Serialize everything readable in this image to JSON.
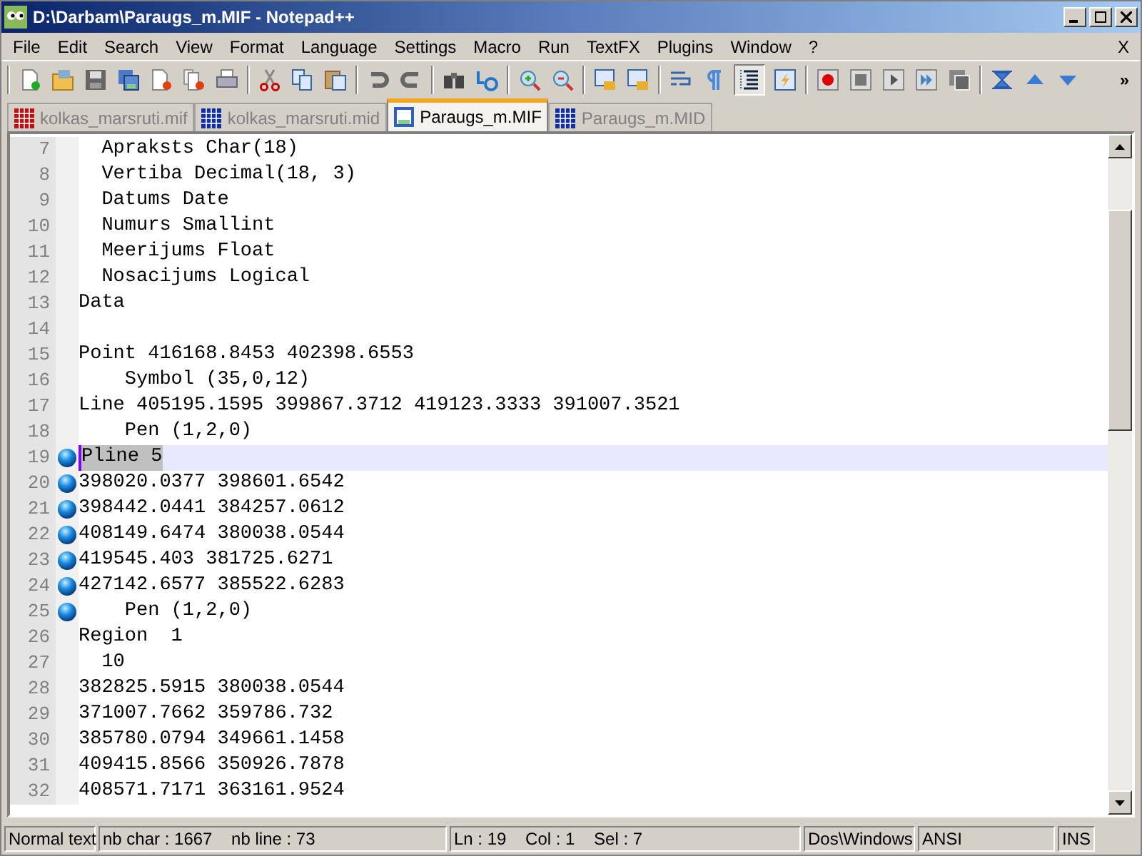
{
  "window": {
    "title": "D:\\Darbam\\Paraugs_m.MIF - Notepad++"
  },
  "menu": [
    "File",
    "Edit",
    "Search",
    "View",
    "Format",
    "Language",
    "Settings",
    "Macro",
    "Run",
    "TextFX",
    "Plugins",
    "Window",
    "?"
  ],
  "menu_close": "X",
  "toolbar": [
    {
      "kind": "new",
      "pressed": false
    },
    {
      "kind": "open",
      "pressed": false
    },
    {
      "kind": "save",
      "pressed": false
    },
    {
      "kind": "saveall",
      "pressed": false
    },
    {
      "kind": "close",
      "pressed": false
    },
    {
      "kind": "closeall",
      "pressed": false
    },
    {
      "kind": "print",
      "pressed": false
    },
    {
      "kind": "sep"
    },
    {
      "kind": "cut",
      "pressed": false
    },
    {
      "kind": "copy",
      "pressed": false
    },
    {
      "kind": "paste",
      "pressed": false
    },
    {
      "kind": "sep"
    },
    {
      "kind": "undo",
      "pressed": false
    },
    {
      "kind": "redo",
      "pressed": false
    },
    {
      "kind": "sep"
    },
    {
      "kind": "find",
      "pressed": false
    },
    {
      "kind": "replace",
      "pressed": false
    },
    {
      "kind": "sep"
    },
    {
      "kind": "zoomin",
      "pressed": false
    },
    {
      "kind": "zoomout",
      "pressed": false
    },
    {
      "kind": "sep"
    },
    {
      "kind": "lock",
      "pressed": false
    },
    {
      "kind": "lock",
      "pressed": false
    },
    {
      "kind": "sep"
    },
    {
      "kind": "wrap",
      "pressed": false
    },
    {
      "kind": "pilcrow",
      "pressed": false
    },
    {
      "kind": "indent",
      "pressed": true
    },
    {
      "kind": "lightning",
      "pressed": false
    },
    {
      "kind": "sep"
    },
    {
      "kind": "record",
      "pressed": false
    },
    {
      "kind": "stop",
      "pressed": false
    },
    {
      "kind": "play",
      "pressed": false
    },
    {
      "kind": "playmulti",
      "pressed": false
    },
    {
      "kind": "savemacro",
      "pressed": false
    },
    {
      "kind": "sep"
    },
    {
      "kind": "sync",
      "pressed": false
    },
    {
      "kind": "up",
      "pressed": false
    },
    {
      "kind": "down",
      "pressed": false
    }
  ],
  "toolbar_more": "»",
  "tabs": [
    {
      "label": "kolkas_marsruti.mif",
      "selected": false,
      "color": "#c01010"
    },
    {
      "label": "kolkas_marsruti.mid",
      "selected": false,
      "color": "#1030a0"
    },
    {
      "label": "Paraugs_m.MIF",
      "selected": true,
      "color": "#3060c0"
    },
    {
      "label": "Paraugs_m.MID",
      "selected": false,
      "color": "#1030a0"
    }
  ],
  "editor": {
    "lines": [
      {
        "number": "7",
        "text": "  Apraksts Char(18)",
        "bookmark": false,
        "current": false
      },
      {
        "number": "8",
        "text": "  Vertiba Decimal(18, 3)",
        "bookmark": false,
        "current": false
      },
      {
        "number": "9",
        "text": "  Datums Date",
        "bookmark": false,
        "current": false
      },
      {
        "number": "10",
        "text": "  Numurs Smallint",
        "bookmark": false,
        "current": false
      },
      {
        "number": "11",
        "text": "  Meerijums Float",
        "bookmark": false,
        "current": false
      },
      {
        "number": "12",
        "text": "  Nosacijums Logical",
        "bookmark": false,
        "current": false
      },
      {
        "number": "13",
        "text": "Data",
        "bookmark": false,
        "current": false
      },
      {
        "number": "14",
        "bookmark": false,
        "current": false
      },
      {
        "number": "15",
        "text": "Point 416168.8453 402398.6553",
        "bookmark": false,
        "current": false
      },
      {
        "number": "16",
        "text": "    Symbol (35,0,12)",
        "bookmark": false,
        "current": false
      },
      {
        "number": "17",
        "text": "Line 405195.1595 399867.3712 419123.3333 391007.3521",
        "bookmark": false,
        "current": false
      },
      {
        "number": "18",
        "text": "    Pen (1,2,0)",
        "bookmark": false,
        "current": false
      },
      {
        "number": "19",
        "text": "Pline 5",
        "bookmark": true,
        "current": true,
        "selected": true
      },
      {
        "number": "20",
        "text": "398020.0377 398601.6542",
        "bookmark": true,
        "current": false
      },
      {
        "number": "21",
        "text": "398442.0441 384257.0612",
        "bookmark": true,
        "current": false
      },
      {
        "number": "22",
        "text": "408149.6474 380038.0544",
        "bookmark": true,
        "current": false
      },
      {
        "number": "23",
        "text": "419545.403 381725.6271",
        "bookmark": true,
        "current": false
      },
      {
        "number": "24",
        "text": "427142.6577 385522.6283",
        "bookmark": true,
        "current": false
      },
      {
        "number": "25",
        "text": "    Pen (1,2,0)",
        "bookmark": true,
        "current": false
      },
      {
        "number": "26",
        "text": "Region  1",
        "bookmark": false,
        "current": false
      },
      {
        "number": "27",
        "text": "  10",
        "bookmark": false,
        "current": false
      },
      {
        "number": "28",
        "text": "382825.5915 380038.0544",
        "bookmark": false,
        "current": false
      },
      {
        "number": "29",
        "text": "371007.7662 359786.732",
        "bookmark": false,
        "current": false
      },
      {
        "number": "30",
        "text": "385780.0794 349661.1458",
        "bookmark": false,
        "current": false
      },
      {
        "number": "31",
        "text": "409415.8566 350926.7878",
        "bookmark": false,
        "current": false
      },
      {
        "number": "32",
        "text": "408571.7171 363161.9524",
        "bookmark": false,
        "current": false
      }
    ]
  },
  "status_bar": [
    "Normal text",
    "nb char : 1667    nb line : 73",
    "Ln : 19    Col : 1    Sel : 7",
    "Dos\\Windows",
    "ANSI",
    "INS"
  ]
}
